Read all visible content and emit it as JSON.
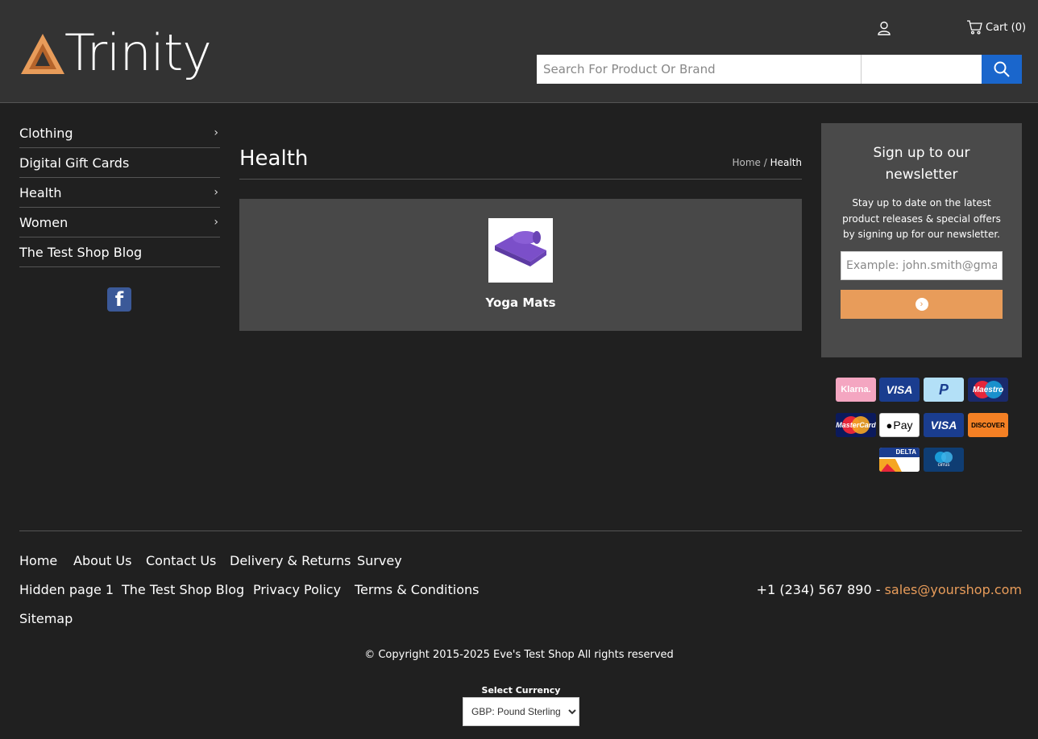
{
  "header": {
    "logo_text": "Trinity",
    "cart_label": "Cart (0)",
    "search_placeholder": "Search For Product Or Brand"
  },
  "sidebar": {
    "items": [
      {
        "label": "Clothing",
        "has_children": true
      },
      {
        "label": "Digital Gift Cards",
        "has_children": false
      },
      {
        "label": "Health",
        "has_children": true
      },
      {
        "label": "Women",
        "has_children": true
      },
      {
        "label": "The Test Shop Blog",
        "has_children": false
      }
    ],
    "chevron": "›"
  },
  "main": {
    "title": "Health",
    "breadcrumb": {
      "home": "Home",
      "separator": " / ",
      "current": "Health"
    },
    "categories": [
      {
        "label": "Yoga Mats"
      }
    ]
  },
  "newsletter": {
    "title": "Sign up to our newsletter",
    "text": "Stay up to date on the latest product releases & special offers by signing up for our newsletter.",
    "placeholder": "Example: john.smith@gmail.com"
  },
  "payments": {
    "klarna": "Klarna.",
    "visa": "VISA",
    "paypal": "P",
    "maestro": "Maestro",
    "mastercard": "MasterCard",
    "applepay": "Pay",
    "visa_debit": "VISA",
    "discover": "DISCOVER",
    "delta": "DELTA",
    "cirrus": "cirrus"
  },
  "footer": {
    "links_row1": [
      "Home",
      "About Us",
      "Contact Us",
      "Delivery & Returns",
      "Survey"
    ],
    "links_row2": [
      "Hidden page 1",
      "The Test Shop Blog",
      "Privacy Policy",
      "Terms & Conditions"
    ],
    "links_row3": [
      "Sitemap"
    ],
    "phone": "+1 (234) 567 890",
    "contact_separator": " - ",
    "email": "sales@yourshop.com",
    "copyright": "© Copyright 2015-2025 Eve's Test Shop All rights reserved",
    "currency_label": "Select Currency",
    "currency_value": "GBP: Pound Sterling"
  },
  "colors": {
    "accent": "#e89c5a",
    "search_button": "#1a66cc",
    "background": "#202020",
    "header_bg": "#333333"
  }
}
